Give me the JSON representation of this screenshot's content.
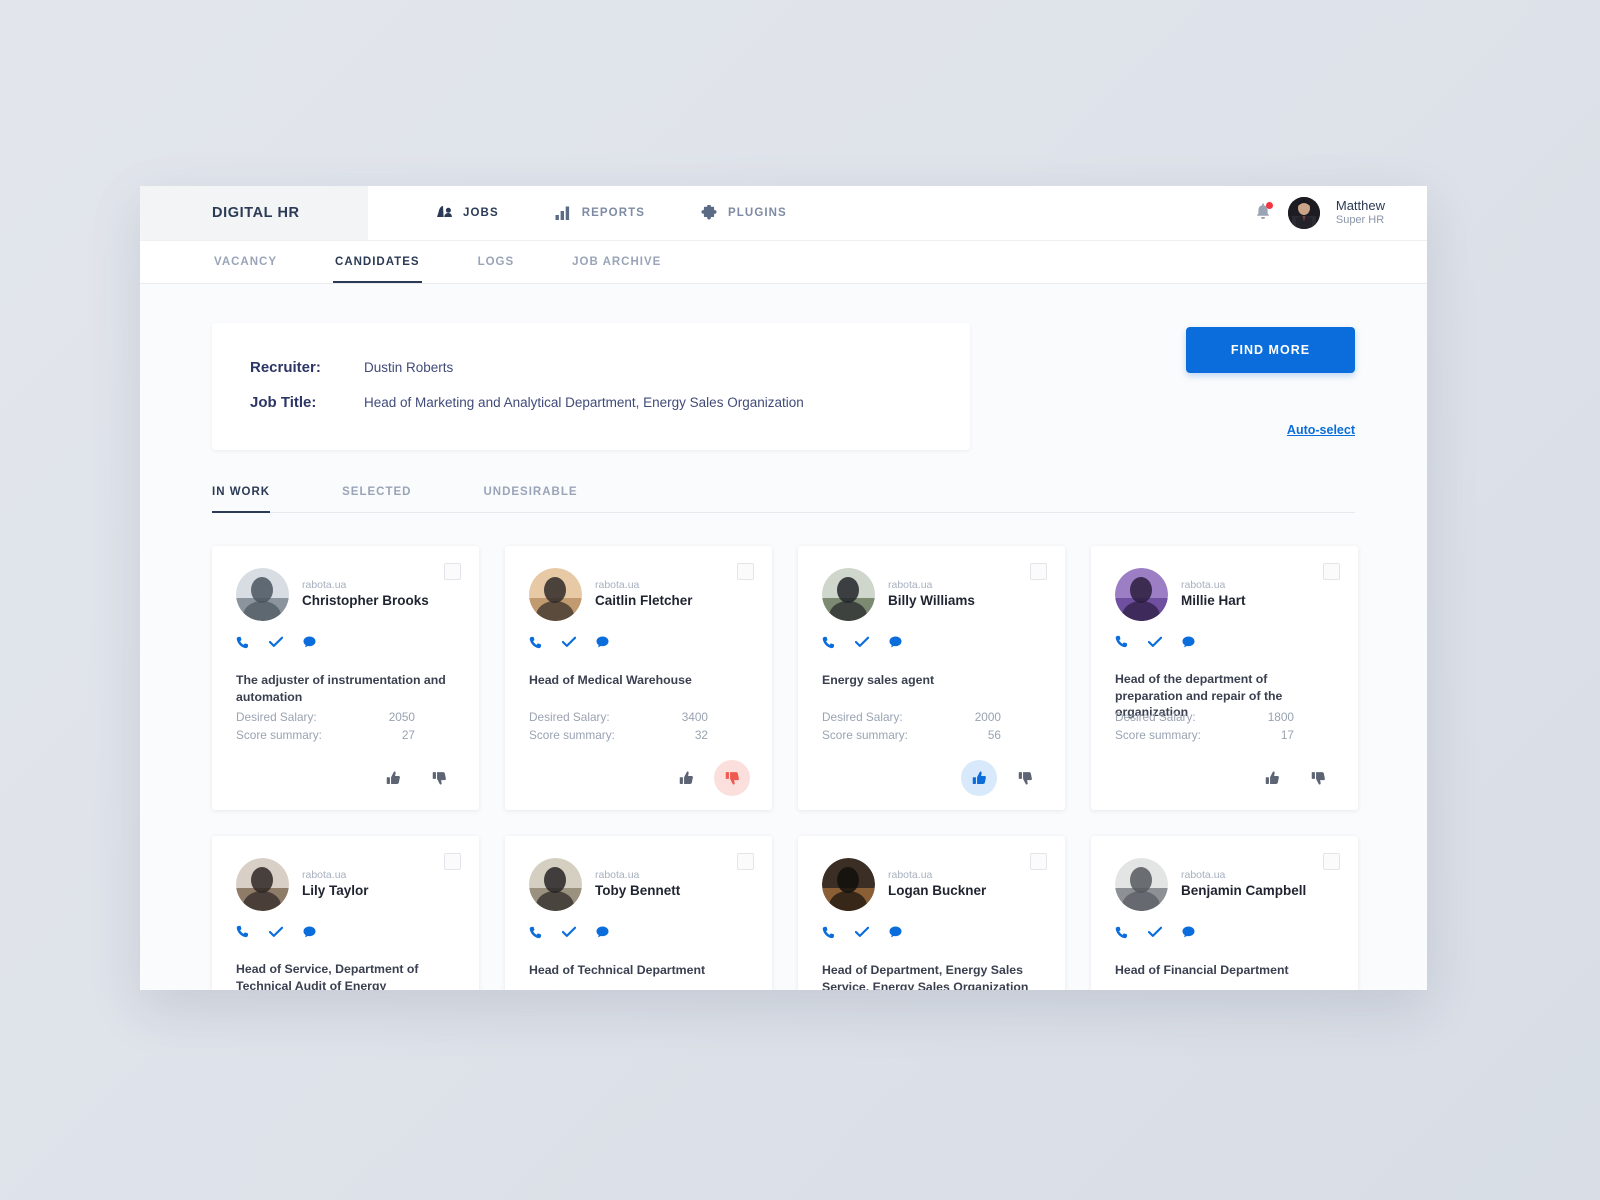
{
  "brand": {
    "name": "DIGITAL HR"
  },
  "topnav": {
    "items": [
      {
        "label": "JOBS",
        "icon": "jobs-icon",
        "active": true
      },
      {
        "label": "REPORTS",
        "icon": "reports-icon",
        "active": false
      },
      {
        "label": "PLUGINS",
        "icon": "plugins-icon",
        "active": false
      }
    ]
  },
  "user": {
    "name": "Matthew",
    "role": "Super HR",
    "notification_icon": "bell-icon",
    "has_notification": true
  },
  "subnav": {
    "items": [
      {
        "label": "VACANCY",
        "active": false
      },
      {
        "label": "CANDIDATES",
        "active": true
      },
      {
        "label": "LOGS",
        "active": false
      },
      {
        "label": "JOB ARCHIVE",
        "active": false
      }
    ]
  },
  "info": {
    "recruiter_label": "Recruiter:",
    "recruiter_value": "Dustin Roberts",
    "job_title_label": "Job Title:",
    "job_title_value": "Head of Marketing and Analytical Department, Energy Sales Organization"
  },
  "actions": {
    "find_more_label": "FIND MORE",
    "auto_select_label": "Auto-select"
  },
  "status_tabs": {
    "items": [
      {
        "label": "IN WORK",
        "active": true
      },
      {
        "label": "SELECTED",
        "active": false
      },
      {
        "label": "UNDESIRABLE",
        "active": false
      }
    ]
  },
  "colors": {
    "accent_blue": "#0a6ddb",
    "dark_navy": "#2b3a55",
    "muted": "#9aa4b8",
    "thumb_up_active_bg": "#d7e9fb",
    "thumb_down_active_bg": "#fbdfdd",
    "thumb_down_active_fill": "#f0594f",
    "notification_dot": "#f4353f"
  },
  "card_labels": {
    "desired_salary": "Desired Salary:",
    "score_summary": "Score summary:"
  },
  "candidates": [
    {
      "source": "rabota.ua",
      "name": "Christopher Brooks",
      "position": "The adjuster of instrumentation and automation",
      "desired_salary": "2050",
      "score_summary": "27",
      "vote": "none",
      "avatar_colors": [
        "#d7dde2",
        "#8b949c",
        "#4a5560"
      ]
    },
    {
      "source": "rabota.ua",
      "name": "Caitlin Fletcher",
      "position": "Head of Medical Warehouse",
      "desired_salary": "3400",
      "score_summary": "32",
      "vote": "down",
      "avatar_colors": [
        "#e8c9a6",
        "#c19a6f",
        "#2f2a28"
      ]
    },
    {
      "source": "rabota.ua",
      "name": "Billy Williams",
      "position": "Energy sales agent",
      "desired_salary": "2000",
      "score_summary": "56",
      "vote": "up",
      "avatar_colors": [
        "#cfd6cb",
        "#7d8a72",
        "#22242a"
      ]
    },
    {
      "source": "rabota.ua",
      "name": "Millie Hart",
      "position": "Head of the department of preparation and repair of the organization",
      "desired_salary": "1800",
      "score_summary": "17",
      "vote": "none",
      "avatar_colors": [
        "#9b7ec4",
        "#6f4fa0",
        "#2b1d3d"
      ]
    },
    {
      "source": "rabota.ua",
      "name": "Lily Taylor",
      "position": "Head of Service, Department of Technical Audit of Energy Consumers",
      "desired_salary": "",
      "score_summary": "",
      "vote": "none",
      "avatar_colors": [
        "#d8cfc6",
        "#8e7b68",
        "#2e2723"
      ]
    },
    {
      "source": "rabota.ua",
      "name": "Toby Bennett",
      "position": "Head of Technical Department",
      "desired_salary": "",
      "score_summary": "",
      "vote": "none",
      "avatar_colors": [
        "#d5cfc2",
        "#9a917e",
        "#262324"
      ]
    },
    {
      "source": "rabota.ua",
      "name": "Logan Buckner",
      "position": "Head of Department, Energy Sales Service, Energy Sales Organization",
      "desired_salary": "",
      "score_summary": "",
      "vote": "none",
      "avatar_colors": [
        "#3b2e24",
        "#8a5f35",
        "#120f0d"
      ]
    },
    {
      "source": "rabota.ua",
      "name": "Benjamin Campbell",
      "position": "Head of Financial Department",
      "desired_salary": "",
      "score_summary": "",
      "vote": "none",
      "avatar_colors": [
        "#e3e5e4",
        "#8d9196",
        "#55595e"
      ]
    }
  ],
  "card_contact_icons": [
    "phone-icon",
    "check-icon",
    "chat-icon"
  ]
}
